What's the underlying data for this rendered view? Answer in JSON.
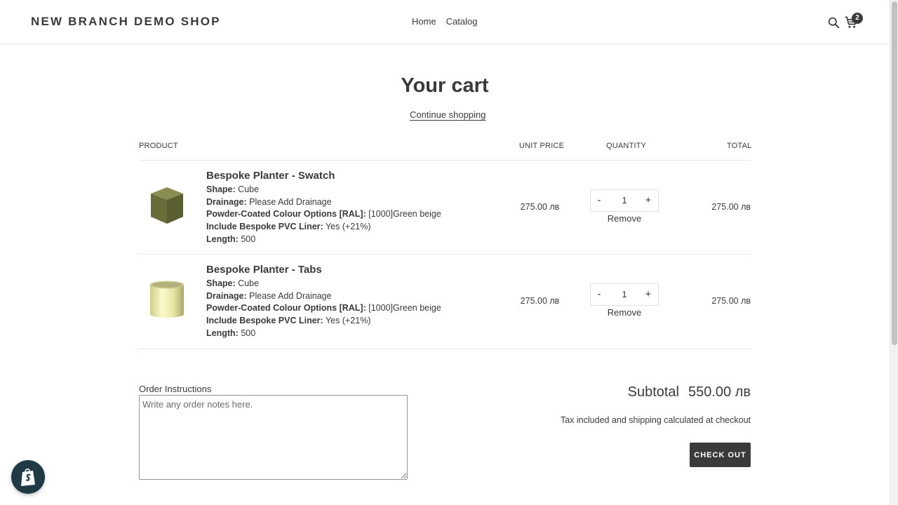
{
  "header": {
    "logo": "NEW BRANCH DEMO SHOP",
    "nav": [
      {
        "label": "Home"
      },
      {
        "label": "Catalog"
      }
    ],
    "search_icon": "search-icon",
    "cart_icon": "cart-icon",
    "cart_count": "2"
  },
  "page": {
    "title": "Your cart",
    "continue_label": "Continue shopping"
  },
  "table": {
    "headers": {
      "product": "PRODUCT",
      "unit_price": "UNIT PRICE",
      "quantity": "QUANTITY",
      "total": "TOTAL"
    }
  },
  "items": [
    {
      "title": "Bespoke Planter - Swatch",
      "image": "olive-cube-swatch",
      "props": [
        {
          "label": "Shape:",
          "value": "Cube"
        },
        {
          "label": "Drainage:",
          "value": "Please Add Drainage"
        },
        {
          "label": "Powder-Coated Colour Options [RAL]:",
          "value": "[1000]Green beige"
        },
        {
          "label": "Include Bespoke PVC Liner:",
          "value": "Yes (+21%)"
        },
        {
          "label": "Length:",
          "value": "500"
        }
      ],
      "unit_price": "275.00 лв",
      "quantity": "1",
      "minus": "-",
      "plus": "+",
      "remove_label": "Remove",
      "line_total": "275.00 лв"
    },
    {
      "title": "Bespoke Planter - Tabs",
      "image": "cream-cylinder-tabs",
      "props": [
        {
          "label": "Shape:",
          "value": "Cube"
        },
        {
          "label": "Drainage:",
          "value": "Please Add Drainage"
        },
        {
          "label": "Powder-Coated Colour Options [RAL]:",
          "value": "[1000]Green beige"
        },
        {
          "label": "Include Bespoke PVC Liner:",
          "value": "Yes (+21%)"
        },
        {
          "label": "Length:",
          "value": "500"
        }
      ],
      "unit_price": "275.00 лв",
      "quantity": "1",
      "minus": "-",
      "plus": "+",
      "remove_label": "Remove",
      "line_total": "275.00 лв"
    }
  ],
  "footer": {
    "notes_label": "Order Instructions",
    "notes_placeholder": "Write any order notes here.",
    "subtotal_label": "Subtotal",
    "subtotal_value": "550.00 лв",
    "tax_note": "Tax included and shipping calculated at checkout",
    "checkout_label": "CHECK OUT",
    "shopify_icon": "shopify-bag-icon"
  },
  "colors": {
    "text": "#3a3a3a",
    "button": "#3a3a3a",
    "border": "#e8e8e8",
    "swatch_olive": "#6b6f3c",
    "cylinder_cream": "#f2f0b4"
  }
}
